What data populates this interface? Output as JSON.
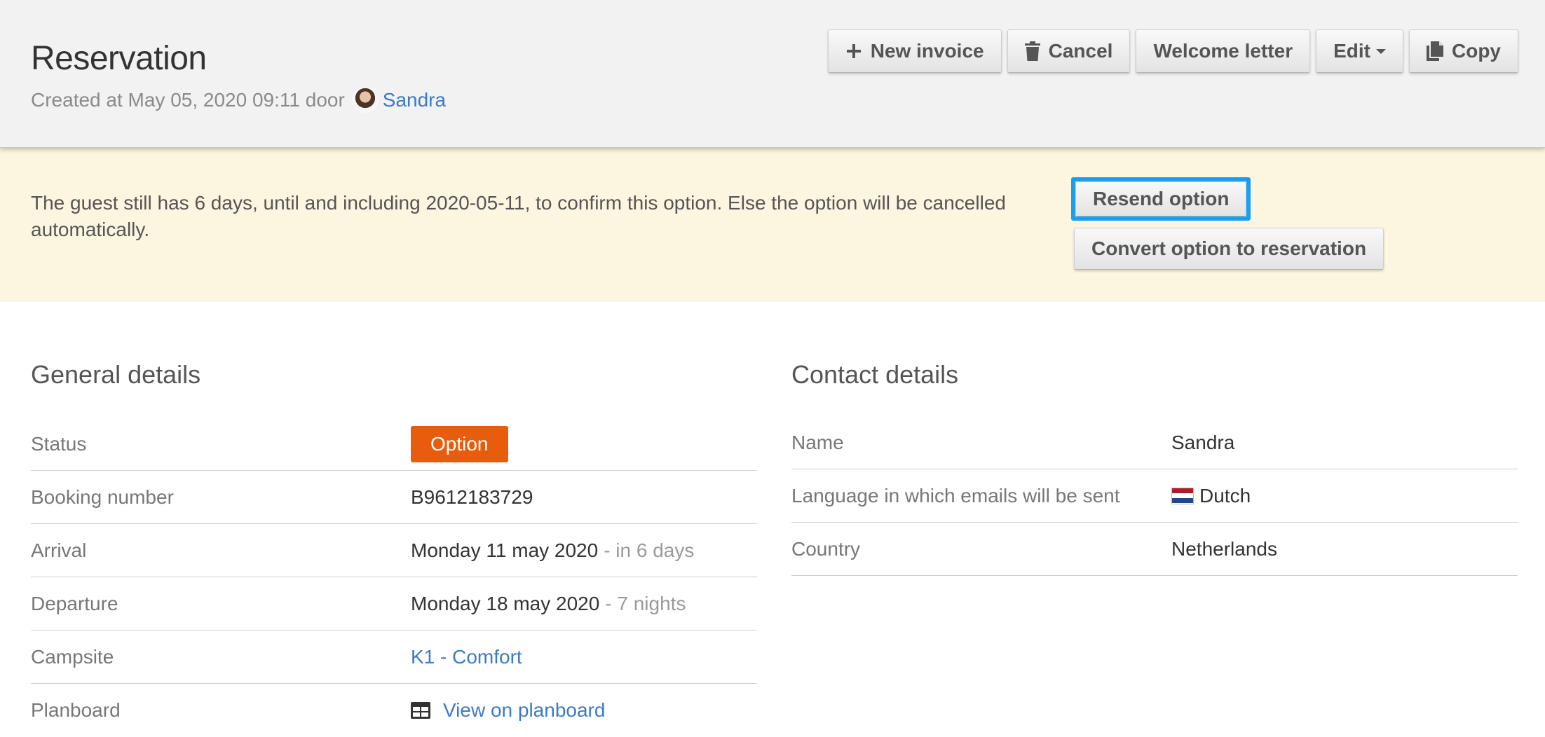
{
  "header": {
    "title": "Reservation",
    "created_prefix": "Created at May 05, 2020 09:11 door",
    "creator_name": "Sandra"
  },
  "toolbar": {
    "new_invoice_label": "New invoice",
    "cancel_label": "Cancel",
    "welcome_letter_label": "Welcome letter",
    "edit_label": "Edit",
    "copy_label": "Copy"
  },
  "notice": {
    "text": "The guest still has 6 days, until and including 2020-05-11, to confirm this option. Else the option will be cancelled automatically.",
    "resend_label": "Resend option",
    "convert_label": "Convert option to reservation"
  },
  "general": {
    "title": "General details",
    "rows": [
      {
        "label": "Status",
        "value": "Option"
      },
      {
        "label": "Booking number",
        "value": "B9612183729"
      },
      {
        "label": "Arrival",
        "value": "Monday 11 may 2020",
        "extra": "- in 6 days"
      },
      {
        "label": "Departure",
        "value": "Monday 18 may 2020",
        "extra": "- 7 nights"
      },
      {
        "label": "Campsite",
        "value": "K1 - Comfort"
      },
      {
        "label": "Planboard",
        "value": "View on planboard"
      }
    ]
  },
  "contact": {
    "title": "Contact details",
    "rows": [
      {
        "label": "Name",
        "value": "Sandra"
      },
      {
        "label": "Language in which emails will be sent",
        "value": "Dutch"
      },
      {
        "label": "Country",
        "value": "Netherlands"
      }
    ]
  },
  "colors": {
    "status_badge": "#e85c0d",
    "link": "#3a7bc8",
    "notice_bg": "#fcf5e0",
    "highlight_border": "#1a9ff0"
  },
  "icons": {
    "new_invoice": "plus-icon",
    "cancel": "trash-icon",
    "edit": "caret-down-icon",
    "copy": "copy-icon",
    "planboard": "grid-icon",
    "language": "dutch-flag-icon"
  }
}
